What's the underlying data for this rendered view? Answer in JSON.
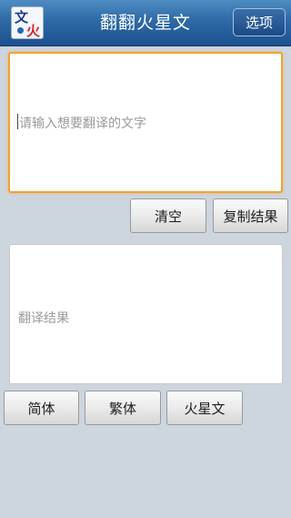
{
  "header": {
    "logo_glyph_top": "文",
    "logo_glyph_bottom": "火",
    "title": "翻翻火星文",
    "options_label": "选项"
  },
  "input": {
    "placeholder": "请输入想要翻译的文字",
    "value": ""
  },
  "actions": {
    "clear_label": "清空",
    "copy_label": "复制结果"
  },
  "result": {
    "placeholder": "翻译结果"
  },
  "modes": {
    "simplified_label": "简体",
    "traditional_label": "繁体",
    "martian_label": "火星文"
  },
  "colors": {
    "header_bg": "#2e6aa6",
    "page_bg": "#cdd5de",
    "input_focus_border": "#f0a232"
  }
}
